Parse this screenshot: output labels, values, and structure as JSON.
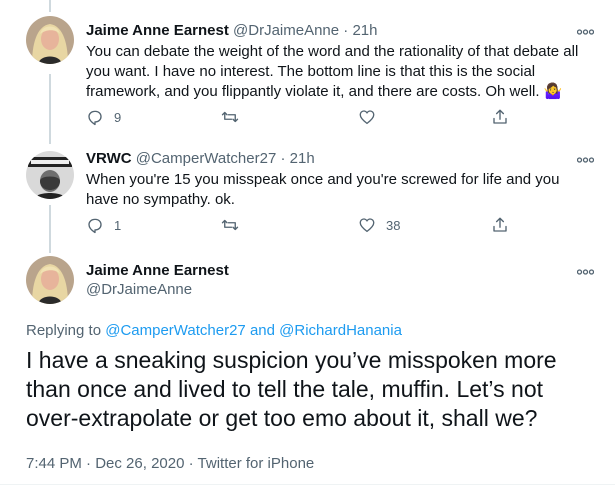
{
  "tweets": [
    {
      "name": "Jaime Anne Earnest",
      "handle": "@DrJaimeAnne",
      "sep": "·",
      "time": "21h",
      "text": "You can debate the weight of the word and the rationality of that debate all you want. I have no interest. The bottom line is that this is the social framework, and you flippantly violate it, and there are costs. Oh well.",
      "emoji": "🤷‍♀️",
      "reply_count": "9",
      "retweet_count": "",
      "like_count": ""
    },
    {
      "name": "VRWC",
      "handle": "@CamperWatcher27",
      "sep": "·",
      "time": "21h",
      "text": "When you're 15 you misspeak once and you're screwed for life and you have no sympathy.  ok.",
      "reply_count": "1",
      "retweet_count": "",
      "like_count": "38"
    }
  ],
  "main_tweet": {
    "name": "Jaime Anne Earnest",
    "handle": "@DrJaimeAnne",
    "replying_prefix": "Replying to",
    "replying_user1": "@CamperWatcher27",
    "replying_and": "and",
    "replying_user2": "@RichardHanania",
    "text": "I have a sneaking suspicion you’ve misspoken more than once and lived to tell the tale, muffin. Let’s not over-extrapolate or get too emo about it, shall we?",
    "time": "7:44 PM",
    "sep1": "·",
    "date": "Dec 26, 2020",
    "sep2": "·",
    "source": "Twitter for iPhone"
  },
  "icons": {
    "more": "more-icon",
    "reply": "reply-icon",
    "retweet": "retweet-icon",
    "like": "like-icon",
    "share": "share-icon"
  },
  "colors": {
    "text": "#0f1419",
    "secondary": "#536471",
    "link": "#1d9bf0",
    "thread_line": "#cfd9de"
  }
}
